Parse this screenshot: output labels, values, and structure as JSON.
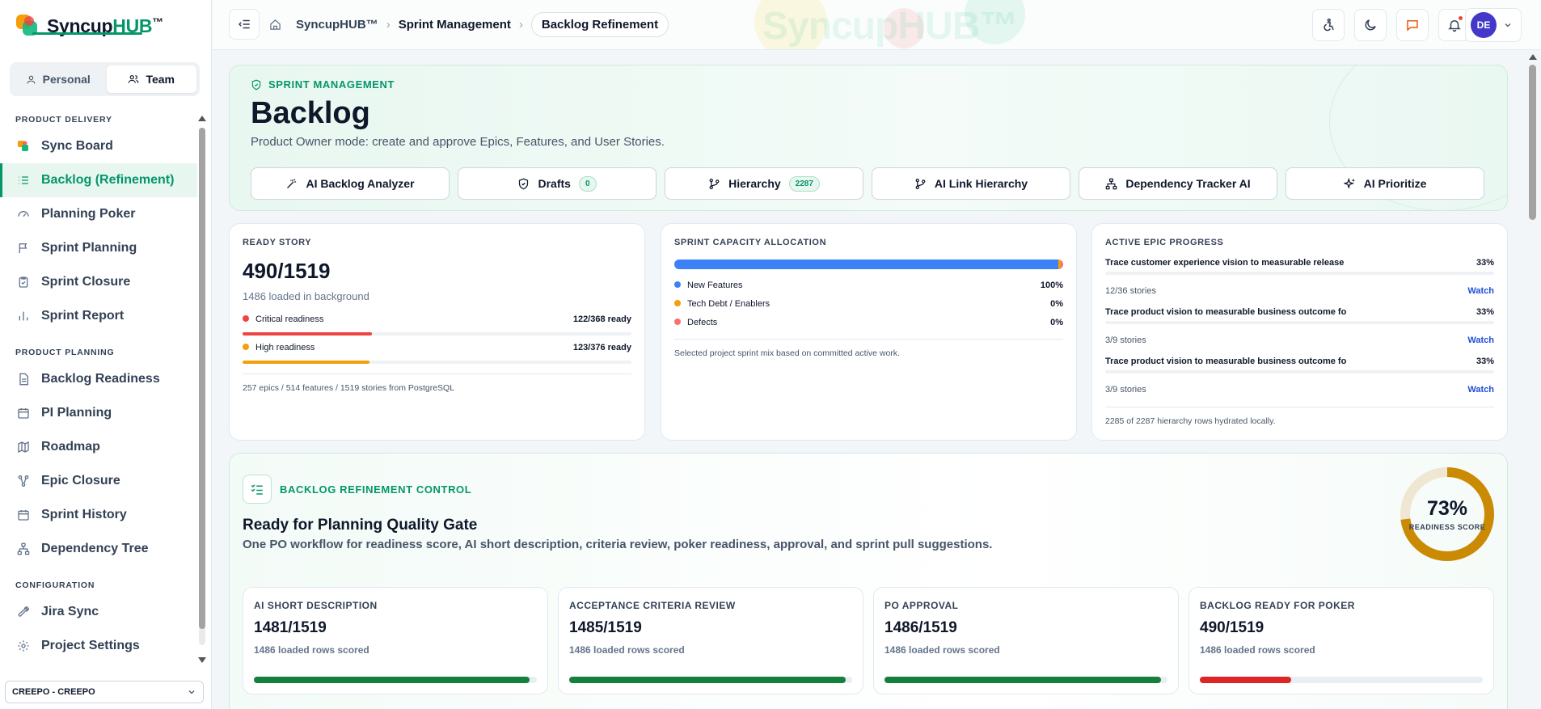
{
  "brand": {
    "name": "Syncup",
    "hub": "HUB",
    "tm": "™"
  },
  "workspace_toggle": {
    "personal": "Personal",
    "team": "Team"
  },
  "sidebar": {
    "sections": [
      {
        "title": "PRODUCT DELIVERY",
        "items": [
          {
            "label": "Sync Board",
            "icon": "sync-board-icon"
          },
          {
            "label": "Backlog (Refinement)",
            "icon": "list-icon",
            "active": true
          },
          {
            "label": "Planning Poker",
            "icon": "gauge-icon"
          },
          {
            "label": "Sprint Planning",
            "icon": "flag-icon"
          },
          {
            "label": "Sprint Closure",
            "icon": "clipboard-check-icon"
          },
          {
            "label": "Sprint Report",
            "icon": "bar-chart-icon"
          }
        ]
      },
      {
        "title": "PRODUCT PLANNING",
        "items": [
          {
            "label": "Backlog Readiness",
            "icon": "document-icon"
          },
          {
            "label": "PI Planning",
            "icon": "calendar-icon"
          },
          {
            "label": "Roadmap",
            "icon": "map-icon"
          },
          {
            "label": "Epic Closure",
            "icon": "nodes-icon"
          },
          {
            "label": "Sprint History",
            "icon": "calendar-icon"
          },
          {
            "label": "Dependency Tree",
            "icon": "tree-icon"
          }
        ]
      },
      {
        "title": "CONFIGURATION",
        "items": [
          {
            "label": "Jira Sync",
            "icon": "wrench-icon"
          },
          {
            "label": "Project Settings",
            "icon": "gear-icon"
          }
        ]
      }
    ],
    "project_select": "CREEPO - CREEPO"
  },
  "topbar": {
    "watermark": "SyncupHUB™",
    "breadcrumbs": [
      "SyncupHUB™",
      "Sprint Management",
      "Backlog Refinement"
    ]
  },
  "user": {
    "initials": "DE"
  },
  "hero": {
    "eyebrow": "SPRINT MANAGEMENT",
    "title": "Backlog",
    "subtitle": "Product Owner mode: create and approve Epics, Features, and User Stories.",
    "actions": [
      {
        "label": "AI Backlog Analyzer",
        "icon": "magic-wand-icon"
      },
      {
        "label": "Drafts",
        "icon": "shield-icon",
        "badge": "0"
      },
      {
        "label": "Hierarchy",
        "icon": "git-branch-icon",
        "badge": "2287"
      },
      {
        "label": "AI Link Hierarchy",
        "icon": "git-branch-icon"
      },
      {
        "label": "Dependency Tracker AI",
        "icon": "network-icon"
      },
      {
        "label": "AI Prioritize",
        "icon": "sparkles-icon"
      }
    ]
  },
  "ready_story": {
    "title": "READY STORY",
    "value": "490/1519",
    "sub": "1486 loaded in background",
    "rows": [
      {
        "label": "Critical readiness",
        "value": "122/368 ready",
        "color": "#ef4444",
        "progress": 0.332
      },
      {
        "label": "High readiness",
        "value": "123/376 ready",
        "color": "#f59e0b",
        "progress": 0.327
      }
    ],
    "footer": "257 epics / 514 features / 1519 stories from PostgreSQL"
  },
  "capacity": {
    "title": "SPRINT CAPACITY ALLOCATION",
    "segments": [
      {
        "label": "New Features",
        "value": "100%",
        "color": "#3b82f6",
        "share": 0.988
      },
      {
        "label": "Tech Debt / Enablers",
        "value": "0%",
        "color": "#f59e0b",
        "share": 0.006
      },
      {
        "label": "Defects",
        "value": "0%",
        "color": "#f87171",
        "share": 0.006
      }
    ],
    "footer": "Selected project sprint mix based on committed active work."
  },
  "epic_progress": {
    "title": "ACTIVE EPIC PROGRESS",
    "items": [
      {
        "name": "Trace customer experience vision to measurable release",
        "pct": "33%",
        "stories": "12/36 stories",
        "action": "Watch"
      },
      {
        "name": "Trace product vision to measurable business outcome fo",
        "pct": "33%",
        "stories": "3/9 stories",
        "action": "Watch"
      },
      {
        "name": "Trace product vision to measurable business outcome fo",
        "pct": "33%",
        "stories": "3/9 stories",
        "action": "Watch"
      }
    ],
    "footer": "2285 of 2287 hierarchy rows hydrated locally."
  },
  "refinement": {
    "eyebrow": "BACKLOG REFINEMENT CONTROL",
    "title": "Ready for Planning Quality Gate",
    "subtitle": "One PO workflow for readiness score, AI short description, criteria review, poker readiness, approval, and sprint pull suggestions.",
    "score": {
      "value": "73%",
      "label": "READINESS SCORE",
      "fraction": 0.73,
      "color": "#ca8a04"
    },
    "metrics": [
      {
        "title": "AI SHORT DESCRIPTION",
        "value": "1481/1519",
        "sub": "1486 loaded rows scored",
        "progress": 0.975,
        "color": "#15803d"
      },
      {
        "title": "ACCEPTANCE CRITERIA REVIEW",
        "value": "1485/1519",
        "sub": "1486 loaded rows scored",
        "progress": 0.978,
        "color": "#15803d"
      },
      {
        "title": "PO APPROVAL",
        "value": "1486/1519",
        "sub": "1486 loaded rows scored",
        "progress": 0.978,
        "color": "#15803d"
      },
      {
        "title": "BACKLOG READY FOR POKER",
        "value": "490/1519",
        "sub": "1486 loaded rows scored",
        "progress": 0.323,
        "color": "#dc2626"
      }
    ]
  }
}
